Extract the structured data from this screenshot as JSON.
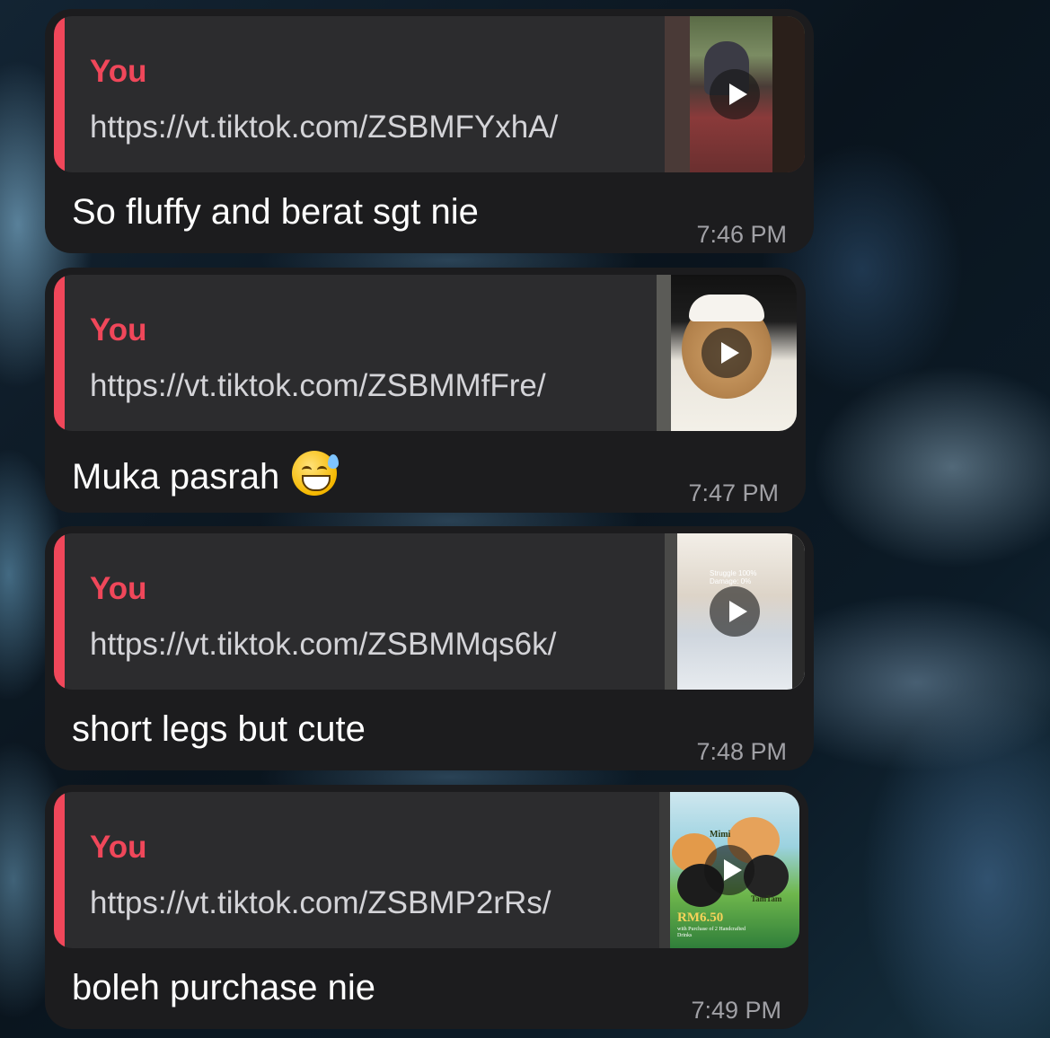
{
  "messages": [
    {
      "sender": "You",
      "link": "https://vt.tiktok.com/ZSBMFYxhA/",
      "text": "So fluffy and berat sgt nie",
      "time": "7:46 PM",
      "thumbnail_icon": "video-play-icon"
    },
    {
      "sender": "You",
      "link": "https://vt.tiktok.com/ZSBMMfFre/",
      "text": "Muka pasrah",
      "emoji": "grinning-face-with-sweat",
      "time": "7:47 PM",
      "thumbnail_icon": "video-play-icon"
    },
    {
      "sender": "You",
      "link": "https://vt.tiktok.com/ZSBMMqs6k/",
      "text": "short legs but cute",
      "time": "7:48 PM",
      "thumbnail_icon": "video-play-icon",
      "thumbnail_caption": "Struggle 100%\nDamage: 0%"
    },
    {
      "sender": "You",
      "link": "https://vt.tiktok.com/ZSBMP2rRs/",
      "text": "boleh purchase nie",
      "time": "7:49 PM",
      "thumbnail_icon": "video-play-icon",
      "thumbnail_labels": {
        "name_one": "Mimi",
        "name_two": "TamTam",
        "price": "RM6.50",
        "price_note": "with Purchase of 2 Handcrafted Drinks"
      }
    }
  ],
  "colors": {
    "accent": "#f0475a",
    "bubble": "#1c1c1e",
    "quote_bg": "#2c2c2e",
    "link_text": "#d4d4d8",
    "time_text": "#a1a1a6"
  }
}
